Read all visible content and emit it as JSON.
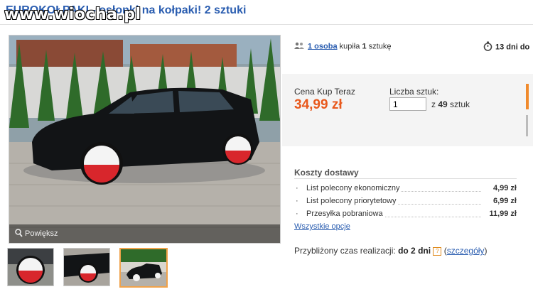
{
  "header": {
    "title": "EUROKOŁPAKI - osłonki na kołpaki! 2 sztuki",
    "watermark": "www.wiocha.pl"
  },
  "gallery": {
    "zoom_label": "Powiększ",
    "selected_thumbnail": 3
  },
  "stats": {
    "buyers_link": "1 osoba",
    "buyers_text": "kupiła",
    "buyers_count": "1",
    "buyers_unit": "sztukę",
    "time_left": "13 dni do"
  },
  "purchase": {
    "price_label": "Cena Kup Teraz",
    "price": "34,99 zł",
    "qty_label": "Liczba sztuk:",
    "qty_value": "1",
    "qty_of_prefix": "z",
    "qty_available": "49",
    "qty_unit": "sztuk"
  },
  "shipping": {
    "title": "Koszty dostawy",
    "options": [
      {
        "name": "List polecony ekonomiczny",
        "price": "4,99 zł"
      },
      {
        "name": "List polecony priorytetowy",
        "price": "6,99 zł"
      },
      {
        "name": "Przesyłka pobraniowa",
        "price": "11,99 zł"
      }
    ],
    "all_options_link": "Wszystkie opcje"
  },
  "realization": {
    "label": "Przybliżony czas realizacji:",
    "value": "do 2 dni",
    "help": "?",
    "details_link": "szczegóły"
  },
  "colors": {
    "link": "#2a5db0",
    "price": "#e8581c",
    "accent": "#f08a2c"
  }
}
